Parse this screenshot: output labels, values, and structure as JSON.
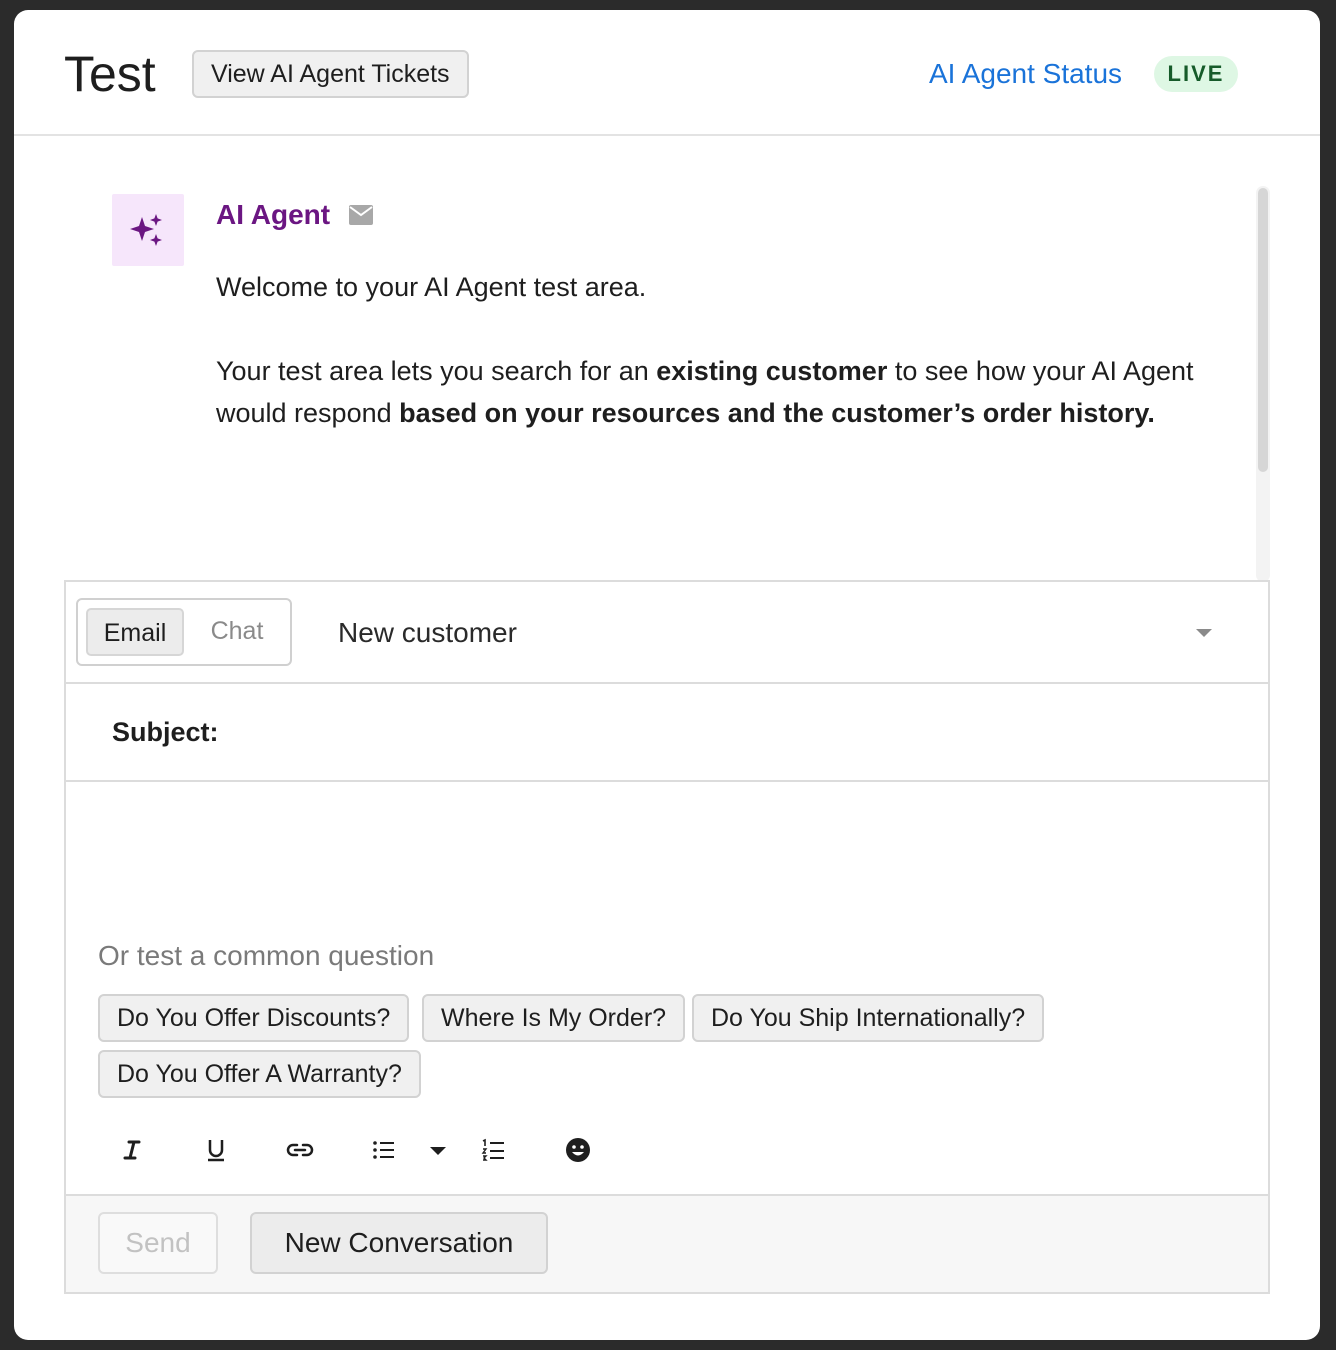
{
  "header": {
    "title": "Test",
    "view_tickets_label": "View AI Agent Tickets",
    "status_link": "AI Agent Status",
    "status_badge": "LIVE"
  },
  "conversation": {
    "sender": "AI Agent",
    "sender_icon": "sparkles-icon",
    "channel_icon": "mail-icon",
    "paragraph1": "Welcome to your AI Agent test area.",
    "p2_a": "Your test area lets you search for an ",
    "p2_b": "existing customer",
    "p2_c": " to see how your AI Agent would respond ",
    "p2_d": "based on your resources and the customer’s order history."
  },
  "composer": {
    "tabs": {
      "email": "Email",
      "chat": "Chat"
    },
    "selected_tab": "Email",
    "customer_select": "New customer",
    "subject_label": "Subject:",
    "subject_value": "",
    "common_question_label": "Or test a common question",
    "suggestions": [
      "Do You Offer Discounts?",
      "Where Is My Order?",
      "Do You Ship Internationally?",
      "Do You Offer A Warranty?"
    ],
    "toolbar": [
      "italic-icon",
      "underline-icon",
      "link-icon",
      "bulleted-list-icon",
      "list-dropdown-icon",
      "numbered-list-icon",
      "emoji-icon"
    ]
  },
  "footer": {
    "send_label": "Send",
    "new_conversation_label": "New Conversation"
  },
  "colors": {
    "link": "#1a73d9",
    "agent": "#6b1682",
    "live_bg": "#def7e4",
    "live_text": "#165b2a"
  }
}
